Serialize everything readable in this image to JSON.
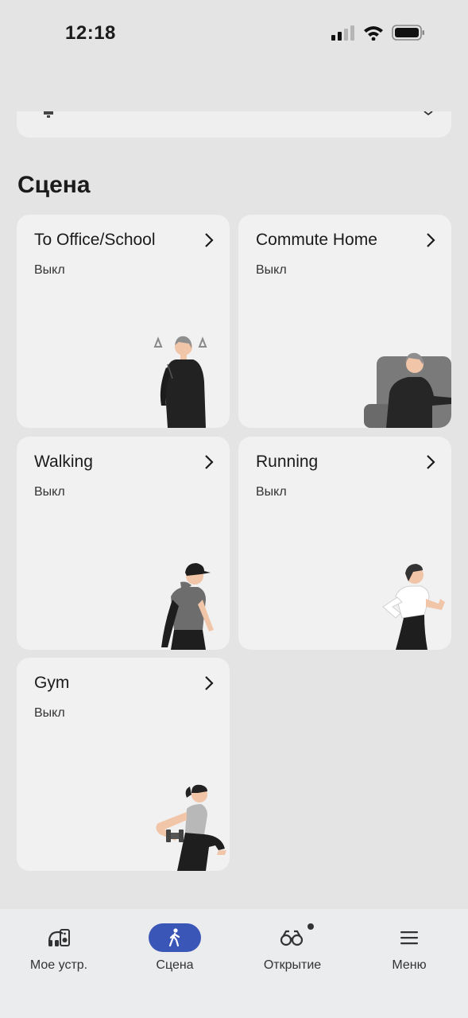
{
  "status_bar": {
    "time": "12:18"
  },
  "section_title": "Сцена",
  "scenes": [
    {
      "title": "To Office/School",
      "status": "Выкл"
    },
    {
      "title": "Commute Home",
      "status": "Выкл"
    },
    {
      "title": "Walking",
      "status": "Выкл"
    },
    {
      "title": "Running",
      "status": "Выкл"
    },
    {
      "title": "Gym",
      "status": "Выкл"
    }
  ],
  "tabs": [
    {
      "label": "Мое устр.",
      "icon": "headphones-speaker-icon",
      "active": false
    },
    {
      "label": "Сцена",
      "icon": "walking-person-icon",
      "active": true
    },
    {
      "label": "Открытие",
      "icon": "binoculars-icon",
      "active": false,
      "badge": true
    },
    {
      "label": "Меню",
      "icon": "hamburger-menu-icon",
      "active": false
    }
  ],
  "colors": {
    "background": "#e4e4e4",
    "card": "#f1f1f1",
    "accent": "#3a57b8",
    "tabbar": "#ebeced"
  }
}
